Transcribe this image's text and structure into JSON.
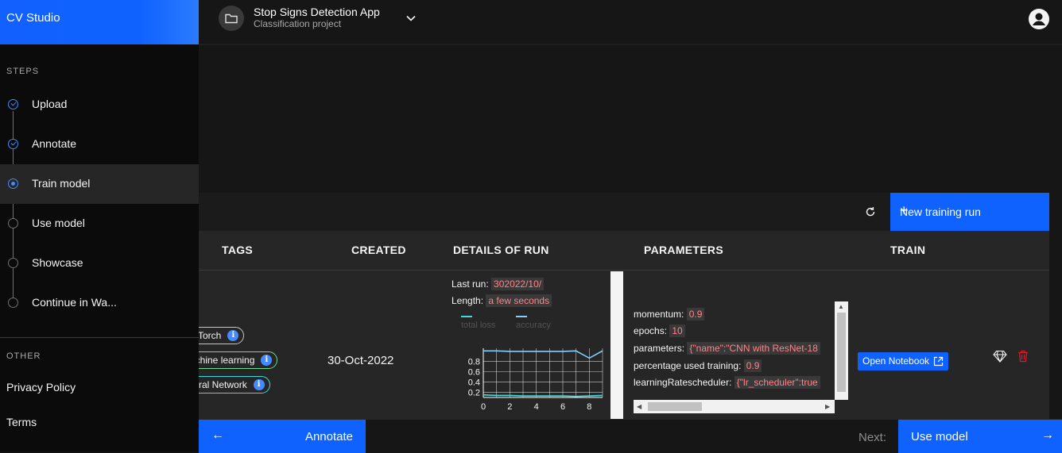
{
  "app": {
    "title": "CV Studio"
  },
  "sidebar": {
    "steps_label": "STEPS",
    "steps": [
      {
        "label": "Upload",
        "state": "done"
      },
      {
        "label": "Annotate",
        "state": "done"
      },
      {
        "label": "Train model",
        "state": "active"
      },
      {
        "label": "Use model",
        "state": "todo"
      },
      {
        "label": "Showcase",
        "state": "todo"
      },
      {
        "label": "Continue in Wa...",
        "state": "todo"
      }
    ],
    "other_label": "OTHER",
    "links": [
      "Privacy Policy",
      "Terms"
    ]
  },
  "header": {
    "project_title": "Stop Signs Detection App",
    "project_subtitle": "Classification project",
    "icons": {
      "project": "folder-icon",
      "menu": "chevron-down-icon",
      "user": "user-avatar-icon"
    }
  },
  "toolbar": {
    "new_run_label": "New training run",
    "new_run_icon": "+",
    "refresh_icon": "refresh-icon"
  },
  "table": {
    "columns": [
      "TAGS",
      "CREATED",
      "DETAILS OF RUN",
      "PARAMETERS",
      "TRAIN"
    ],
    "row": {
      "tags": [
        "PyTorch",
        "Machine learning",
        "Neural Network"
      ],
      "created": "30-Oct-2022",
      "details": {
        "last_run_key": "Last run:",
        "last_run_value": "302022/10/",
        "length_key": "Length:",
        "length_value": "a few seconds"
      },
      "parameters": [
        {
          "key": "momentum:",
          "value": "0.9"
        },
        {
          "key": "epochs:",
          "value": "10"
        },
        {
          "key": "parameters:",
          "value": "{\"name\":\"CNN with ResNet-18"
        },
        {
          "key": "percentage used training:",
          "value": "0.9"
        },
        {
          "key": "learningRatescheduler:",
          "value": "{\"lr_scheduler\":true"
        }
      ],
      "train": {
        "open_notebook_label": "Open Notebook"
      }
    }
  },
  "chart_data": {
    "type": "line",
    "x": [
      0,
      1,
      2,
      3,
      4,
      5,
      6,
      7,
      8,
      9
    ],
    "series": [
      {
        "name": "total loss",
        "color": "#3ddbd9",
        "values": [
          0.15,
          0.14,
          0.14,
          0.13,
          0.13,
          0.13,
          0.13,
          0.12,
          0.13,
          0.14
        ]
      },
      {
        "name": "accuracy",
        "color": "#82cfff",
        "values": [
          1.0,
          1.0,
          0.99,
          0.99,
          0.99,
          0.99,
          0.99,
          1.0,
          0.86,
          1.0
        ]
      }
    ],
    "xticks": [
      "0",
      "2",
      "4",
      "6",
      "8"
    ],
    "yticks": [
      "0.2",
      "0.4",
      "0.6",
      "0.8"
    ],
    "xlim": [
      0,
      9
    ],
    "ylim": [
      0.1,
      1.05
    ],
    "grid": true,
    "legend": "top"
  },
  "footer": {
    "back_label": "Annotate",
    "next_prefix": "Next:",
    "next_label": "Use model",
    "back_arrow": "←",
    "next_arrow": "→"
  }
}
